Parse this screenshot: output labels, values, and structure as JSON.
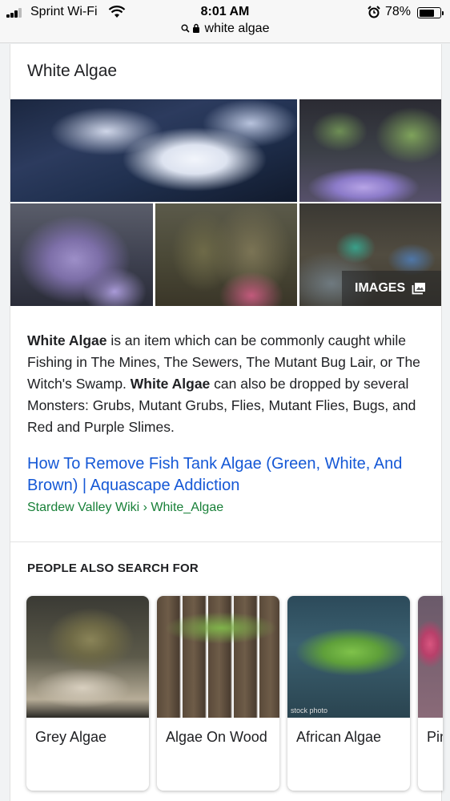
{
  "status_bar": {
    "carrier": "Sprint Wi-Fi",
    "time": "8:01 AM",
    "battery": "78%",
    "battery_level": 0.78
  },
  "url_bar": {
    "query": "white algae"
  },
  "knowledge_panel": {
    "title": "White Algae",
    "images_button": "IMAGES",
    "description": {
      "bold_1": "White Algae",
      "text_1": " is an item which can be commonly caught while Fishing in The Mines, The Sewers, The Mutant Bug Lair, or The Witch's Swamp. ",
      "bold_2": "White Algae",
      "text_2": " can also be dropped by several Monsters: Grubs, Mutant Grubs, Flies, Mutant Flies, Bugs, and Red and Purple Slimes."
    },
    "link_title": "How To Remove Fish Tank Algae (Green, White, And Brown) | Aquascape Addiction",
    "cite": "Stardew Valley Wiki › White_Algae"
  },
  "people_also_search": {
    "heading": "PEOPLE ALSO SEARCH FOR",
    "items": [
      {
        "label": "Grey Algae"
      },
      {
        "label": "Algae On Wood"
      },
      {
        "label": "African Algae",
        "watermark": "stock photo"
      },
      {
        "label": "Pink"
      }
    ]
  },
  "colors": {
    "link": "#1558d6",
    "cite": "#188038",
    "text": "#202124"
  }
}
